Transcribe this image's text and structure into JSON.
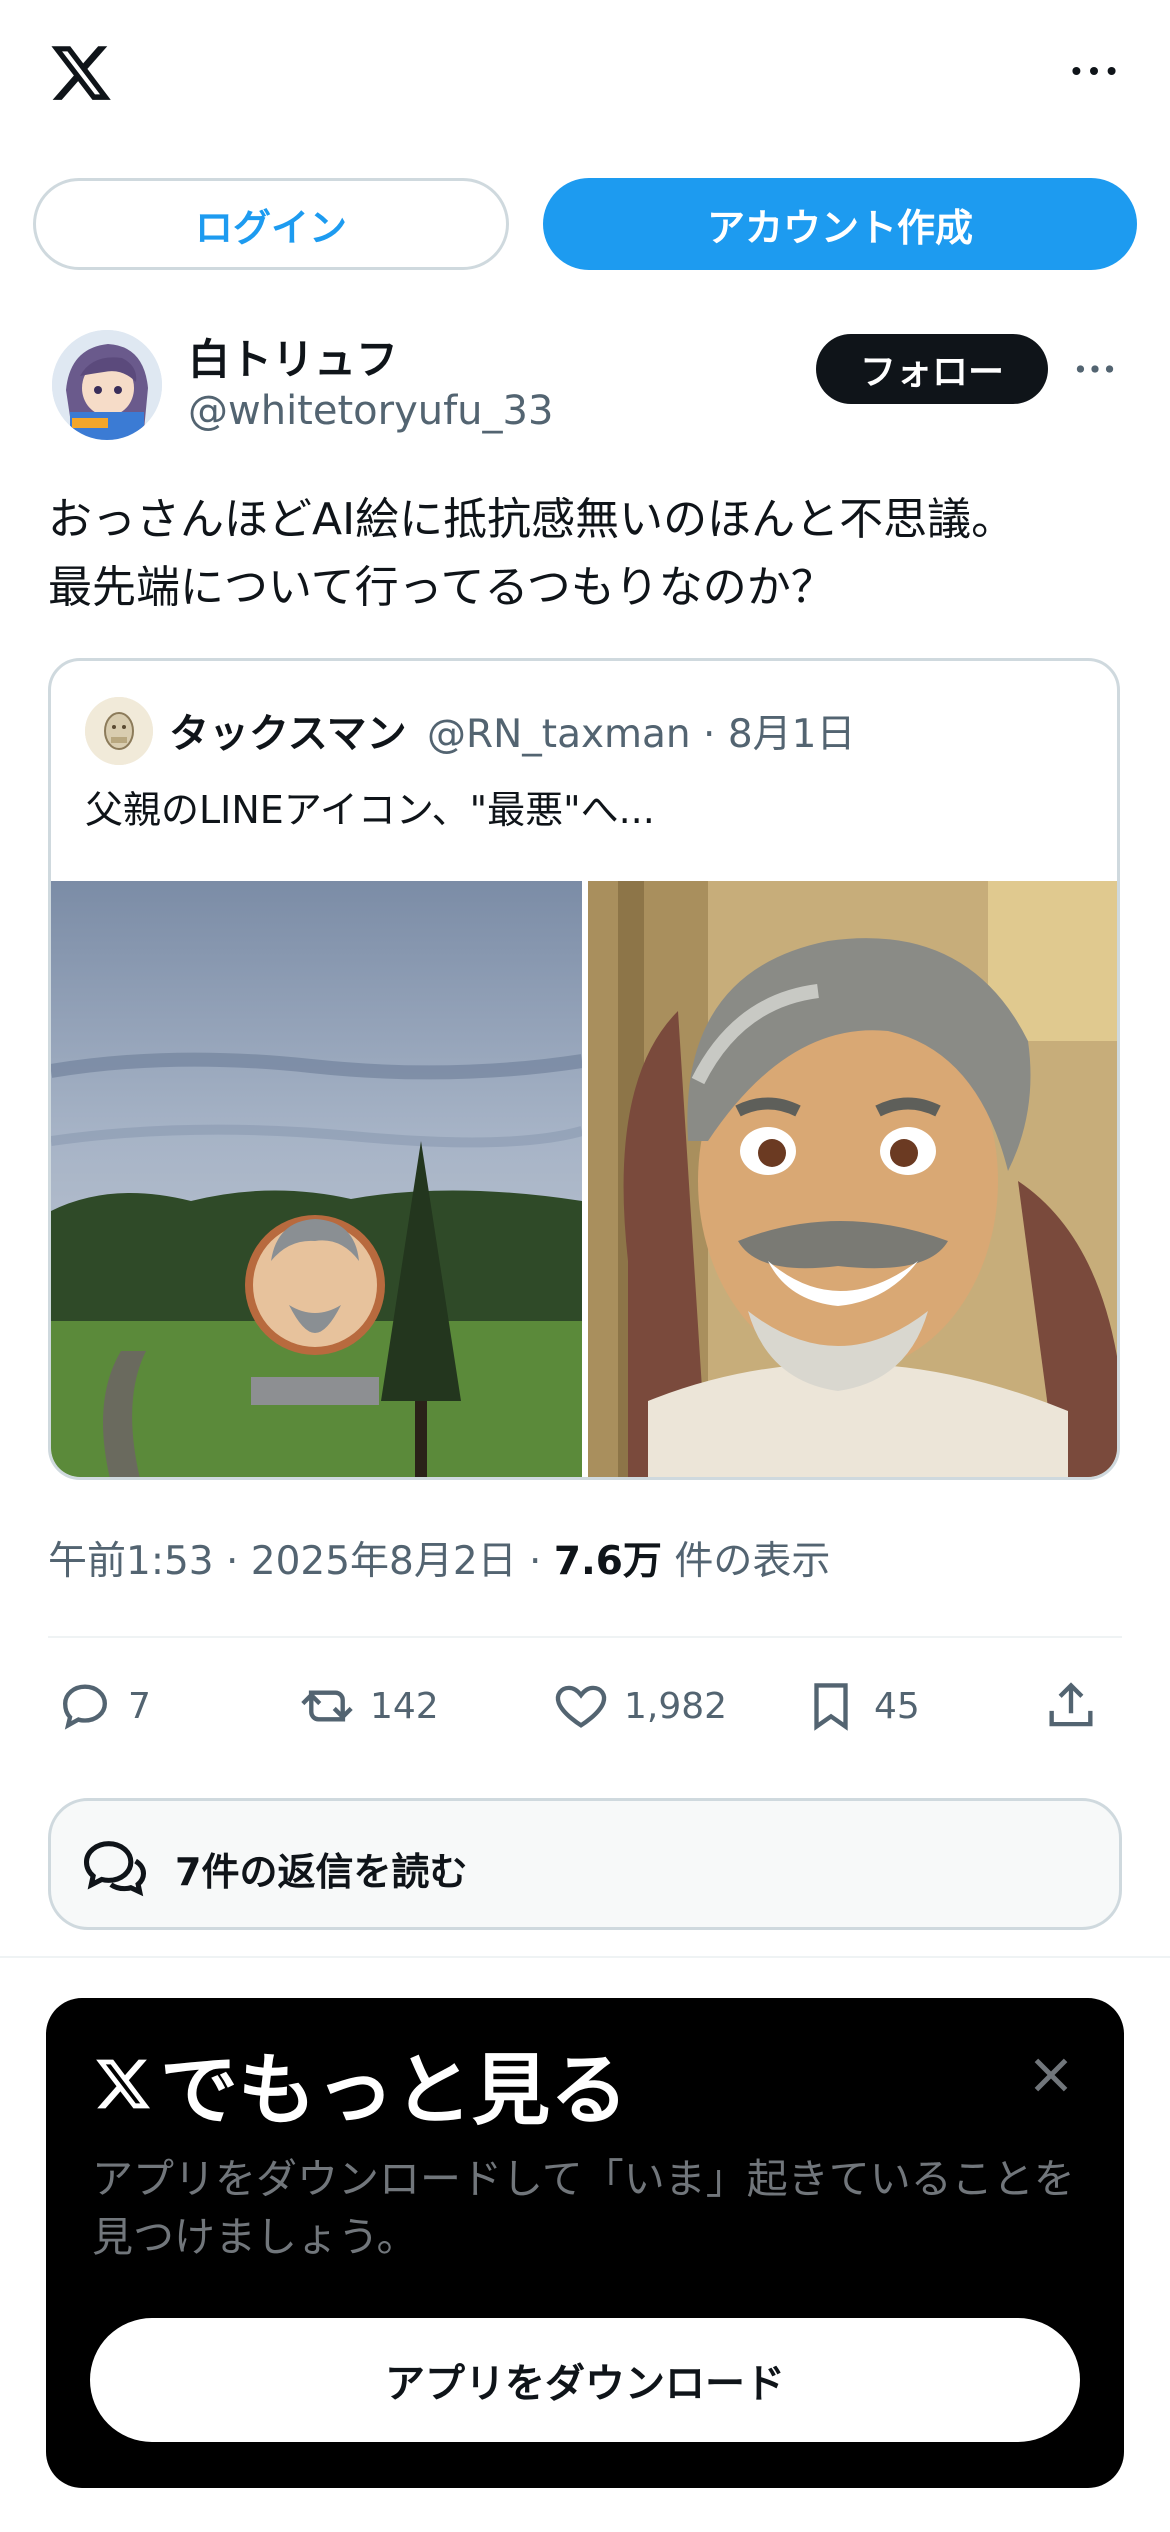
{
  "header": {
    "logo_icon": "x-logo-icon",
    "more_icon": "more-horizontal-icon"
  },
  "auth": {
    "login_label": "ログイン",
    "signup_label": "アカウント作成"
  },
  "post": {
    "author_name": "白トリュフ",
    "author_handle": "@whitetoryufu_33",
    "follow_label": "フォロー",
    "text": "おっさんほどAI絵に抵抗感無いのほんと不思議。\n最先端について行ってるつもりなのか？",
    "quote": {
      "name": "タックスマン",
      "meta": "@RN_taxman · 8月1日",
      "text": "父親のLINEアイコン、\"最悪\"へ..."
    },
    "timestamp_prefix": "午前1:53 · 2025年8月2日 · ",
    "views_count": "7.6万",
    "views_suffix": " 件の表示",
    "actions": {
      "replies": "7",
      "reposts": "142",
      "likes": "1,982",
      "bookmarks": "45"
    },
    "read_replies_label": "7件の返信を読む"
  },
  "promo": {
    "title": "でもっと見る",
    "description": "アプリをダウンロードして「いま」起きていることを見つけましょう。",
    "button_label": "アプリをダウンロード"
  },
  "colors": {
    "accent": "#1d9bf0",
    "text": "#0f1419",
    "secondary": "#536471",
    "border": "#cfd9de"
  }
}
